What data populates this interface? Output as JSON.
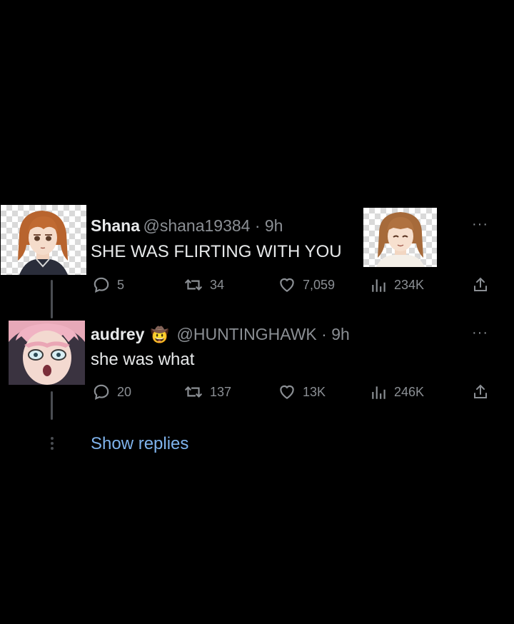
{
  "tweets": [
    {
      "name": "Shana",
      "handle": "@shana19384 · 9h",
      "text": "SHE WAS FLIRTING WITH YOU",
      "replies": "5",
      "retweets": "34",
      "likes": "7,059",
      "views": "234K"
    },
    {
      "name": "audrey",
      "badge_emoji": "🤠",
      "handle": "@HUNTINGHAWK · 9h",
      "text": "she was what",
      "replies": "20",
      "retweets": "137",
      "likes": "13K",
      "views": "246K"
    }
  ],
  "show_replies": "Show replies",
  "more_glyph": "···",
  "colors": {
    "background": "#000000",
    "text": "#e7e9ea",
    "muted": "#8b8f94",
    "link": "#7fb3ec"
  }
}
